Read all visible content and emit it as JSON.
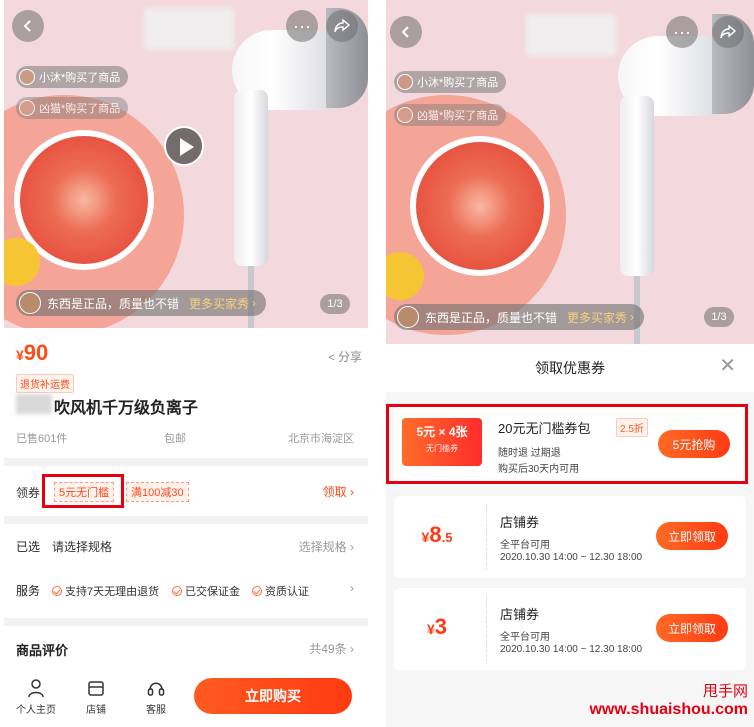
{
  "left": {
    "buyers": [
      "小沐*购买了商品",
      "凶猫*购买了商品"
    ],
    "review": {
      "text": "东西是正品，质量也不错",
      "more": "更多买家秀"
    },
    "image_counter": "1/3",
    "price": {
      "currency": "¥",
      "value": "90"
    },
    "share_label": "分享",
    "return_tag": "退货补运费",
    "title": "吹风机千万级负离子",
    "sold": "已售601件",
    "shipping": "包邮",
    "location": "北京市海淀区",
    "coupon_row": {
      "label": "领券",
      "tag1": "5元无门槛",
      "tag2": "满100减30",
      "action": "领取"
    },
    "spec_row": {
      "label": "已选",
      "value": "请选择规格",
      "action": "选择规格"
    },
    "service_row": {
      "label": "服务",
      "items": [
        "支持7天无理由退货",
        "已交保证金",
        "资质认证"
      ]
    },
    "review_row": {
      "label": "商品评价",
      "count": "共49条"
    },
    "tabbar": {
      "home": "个人主页",
      "shop": "店铺",
      "service": "客服",
      "buy": "立即购买"
    }
  },
  "right": {
    "buyers": [
      "小沐*购买了商品",
      "凶猫*购买了商品"
    ],
    "review": {
      "text": "东西是正品，质量也不错",
      "more": "更多买家秀"
    },
    "image_counter": "1/3",
    "sheet_title": "领取优惠券",
    "package": {
      "badge_main": "5元 × 4张",
      "badge_sub": "无门槛券",
      "title": "20元无门槛券包",
      "discount": "2.5折",
      "line1": "随时退  过期退",
      "line2": "购买后30天内可用",
      "button": "5元抢购"
    },
    "coupons": [
      {
        "currency": "¥",
        "big": "8",
        "small": ".5",
        "title": "店铺券",
        "scope": "全平台可用",
        "period": "2020.10.30 14:00 ~ 12.30 18:00",
        "button": "立即领取"
      },
      {
        "currency": "¥",
        "big": "3",
        "small": "",
        "title": "店铺券",
        "scope": "全平台可用",
        "period": "2020.10.30 14:00 ~ 12.30 18:00",
        "button": "立即领取"
      }
    ]
  },
  "watermark": {
    "line1": "甩手网",
    "line2": "www.shuaishou.com"
  },
  "colors": {
    "accent": "#ff4a1a",
    "highlight_box": "#e60012",
    "hero_bg": "#f3d9de"
  },
  "icons": [
    "back-arrow-icon",
    "more-dots-icon",
    "share-icon",
    "play-icon",
    "close-icon",
    "person-icon",
    "shop-icon",
    "headset-icon"
  ]
}
